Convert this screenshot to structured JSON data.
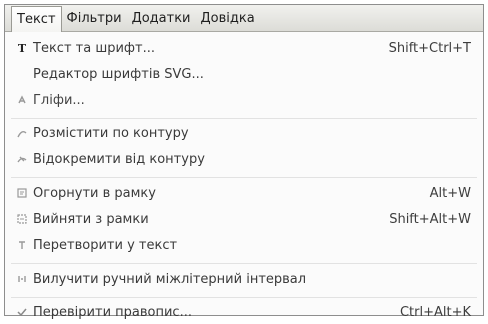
{
  "menubar": {
    "items": [
      {
        "label": "Текст"
      },
      {
        "label": "Фільтри"
      },
      {
        "label": "Додатки"
      },
      {
        "label": "Довідка"
      }
    ]
  },
  "menu": {
    "items": [
      {
        "label": "Текст та шрифт...",
        "shortcut": "Shift+Ctrl+T",
        "icon": "text-tool-icon"
      },
      {
        "label": "Редактор шрифтів SVG...",
        "shortcut": "",
        "icon": ""
      },
      {
        "label": "Гліфи...",
        "shortcut": "",
        "icon": "glyphs-icon"
      },
      {
        "label": "Розмістити по контуру",
        "shortcut": "",
        "icon": "text-on-path-icon"
      },
      {
        "label": "Відокремити від контуру",
        "shortcut": "",
        "icon": "remove-from-path-icon"
      },
      {
        "label": "Огорнути в рамку",
        "shortcut": "Alt+W",
        "icon": "flow-into-frame-icon"
      },
      {
        "label": "Вийняти з рамки",
        "shortcut": "Shift+Alt+W",
        "icon": "unflow-icon"
      },
      {
        "label": "Перетворити у текст",
        "shortcut": "",
        "icon": "convert-to-text-icon"
      },
      {
        "label": "Вилучити ручний міжлітерний інтервал",
        "shortcut": "",
        "icon": "remove-kerns-icon"
      },
      {
        "label": "Перевірити правопис...",
        "shortcut": "Ctrl+Alt+K",
        "icon": "spellcheck-icon"
      }
    ]
  }
}
